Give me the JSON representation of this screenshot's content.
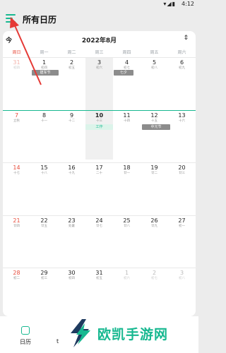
{
  "status_bar": {
    "time": "4:12",
    "icons": [
      "wifi-icon",
      "signal-icon",
      "battery-icon"
    ]
  },
  "header": {
    "title": "所有日历",
    "menu_icon": "menu-icon"
  },
  "calendar": {
    "today_label": "今",
    "month_title": "2022年8月",
    "expand_icon": "expand-icon",
    "weekdays": [
      "周日",
      "周一",
      "周二",
      "周三",
      "周四",
      "周五",
      "周六"
    ],
    "weeks": [
      {
        "days": [
          {
            "num": "31",
            "lunar": "初四",
            "faded": true
          },
          {
            "num": "1",
            "lunar": "初四"
          },
          {
            "num": "2",
            "lunar": "初五"
          },
          {
            "num": "3",
            "lunar": "初六"
          },
          {
            "num": "4",
            "lunar": "初七"
          },
          {
            "num": "5",
            "lunar": "初八"
          },
          {
            "num": "6",
            "lunar": "初九"
          }
        ]
      },
      {
        "days": [
          {
            "num": "7",
            "lunar": "立秋"
          },
          {
            "num": "8",
            "lunar": "十一"
          },
          {
            "num": "9",
            "lunar": "十二"
          },
          {
            "num": "10",
            "lunar": "十三",
            "today": true
          },
          {
            "num": "11",
            "lunar": "十四"
          },
          {
            "num": "12",
            "lunar": "十五"
          },
          {
            "num": "13",
            "lunar": "十六"
          }
        ]
      },
      {
        "days": [
          {
            "num": "14",
            "lunar": "十七"
          },
          {
            "num": "15",
            "lunar": "十八"
          },
          {
            "num": "16",
            "lunar": "十九"
          },
          {
            "num": "17",
            "lunar": "二十"
          },
          {
            "num": "18",
            "lunar": "廿一"
          },
          {
            "num": "19",
            "lunar": "廿二"
          },
          {
            "num": "20",
            "lunar": "廿三"
          }
        ]
      },
      {
        "days": [
          {
            "num": "21",
            "lunar": "廿四"
          },
          {
            "num": "22",
            "lunar": "廿五"
          },
          {
            "num": "23",
            "lunar": "处暑"
          },
          {
            "num": "24",
            "lunar": "廿七"
          },
          {
            "num": "25",
            "lunar": "廿八"
          },
          {
            "num": "26",
            "lunar": "廿九"
          },
          {
            "num": "27",
            "lunar": "初一"
          }
        ]
      },
      {
        "days": [
          {
            "num": "28",
            "lunar": "初二"
          },
          {
            "num": "29",
            "lunar": "初三"
          },
          {
            "num": "30",
            "lunar": "初四"
          },
          {
            "num": "31",
            "lunar": "初五"
          },
          {
            "num": "1",
            "lunar": "初六",
            "faded": true
          },
          {
            "num": "2",
            "lunar": "初七",
            "faded": true
          },
          {
            "num": "3",
            "lunar": "初八",
            "faded": true
          }
        ]
      }
    ],
    "events": [
      {
        "label": "建军节",
        "color": "grey"
      },
      {
        "label": "七夕",
        "color": "grey"
      },
      {
        "label": "工作",
        "color": "green"
      },
      {
        "label": "中元节",
        "color": "grey"
      }
    ]
  },
  "bottom_nav": {
    "items": [
      {
        "label": "日历",
        "icon": "calendar-icon"
      }
    ],
    "partial_label": "t"
  },
  "watermark": {
    "text": "欧凯手游网"
  }
}
